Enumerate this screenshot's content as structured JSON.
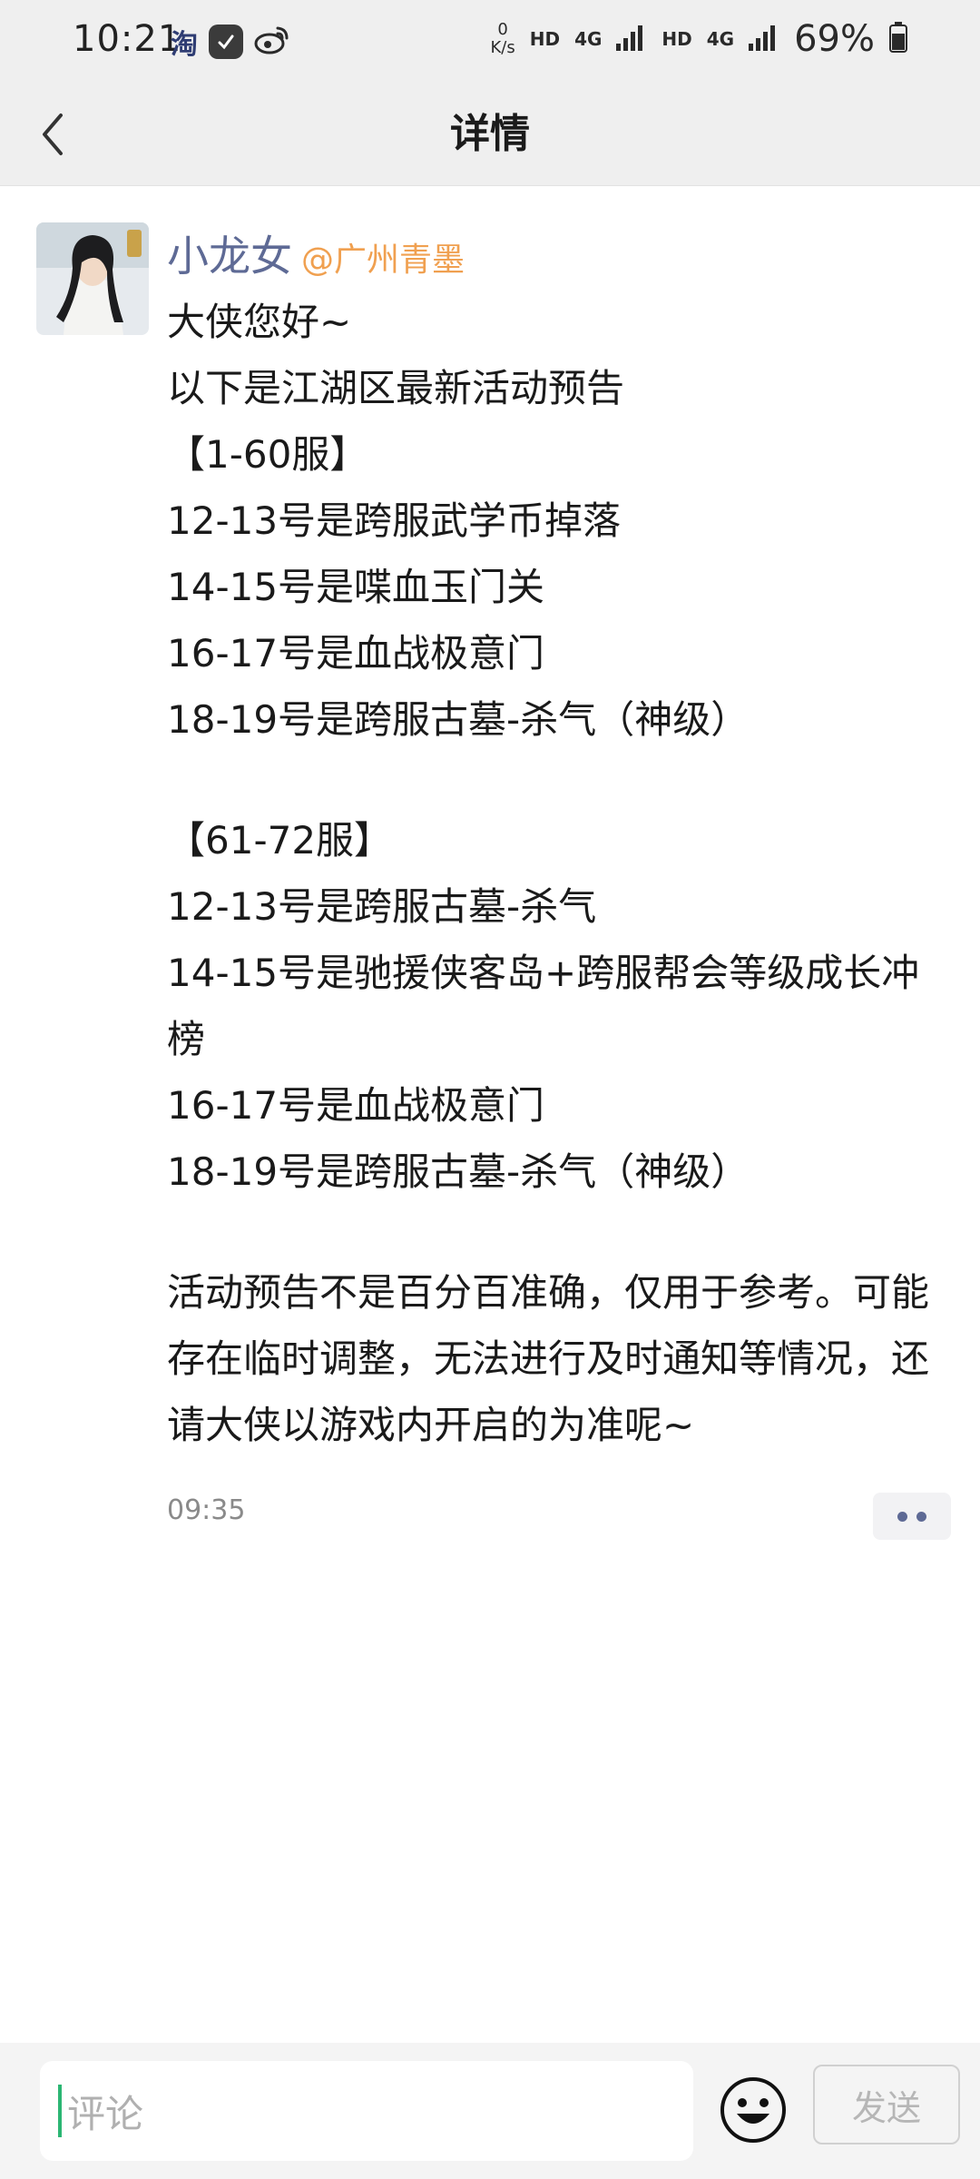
{
  "status_bar": {
    "time": "10:21",
    "app_icon_taobao": "淘",
    "net_speed_value": "0",
    "net_speed_unit": "K/s",
    "hd1": "HD",
    "net1": "4G",
    "hd2": "HD",
    "net2": "4G",
    "battery": "69%",
    "icons": [
      "taobao-icon",
      "app-badge-icon",
      "weibo-icon",
      "signal-icon",
      "battery-icon"
    ]
  },
  "header": {
    "title": "详情",
    "back_icon": "chevron-left-icon"
  },
  "post": {
    "username": "小龙女",
    "handle": "@广州青墨",
    "lines_block1": [
      "大侠您好~",
      "以下是江湖区最新活动预告",
      "【1-60服】",
      "12-13号是跨服武学币掉落",
      "14-15号是喋血玉门关",
      "16-17号是血战极意门",
      "18-19号是跨服古墓-杀气（神级）"
    ],
    "lines_block2": [
      "【61-72服】",
      "12-13号是跨服古墓-杀气",
      "14-15号是驰援侠客岛+跨服帮会等级成长冲榜",
      "16-17号是血战极意门",
      "18-19号是跨服古墓-杀气（神级）"
    ],
    "note": "活动预告不是百分百准确，仅用于参考。可能存在临时调整，无法进行及时通知等情况，还请大侠以游戏内开启的为准呢~",
    "time": "09:35"
  },
  "comment_bar": {
    "placeholder": "评论",
    "send_label": "发送",
    "emoji_icon": "smiley-icon"
  },
  "colors": {
    "accent_name": "#5e6a95",
    "handle": "#f0a050",
    "cursor": "#2bb673"
  }
}
